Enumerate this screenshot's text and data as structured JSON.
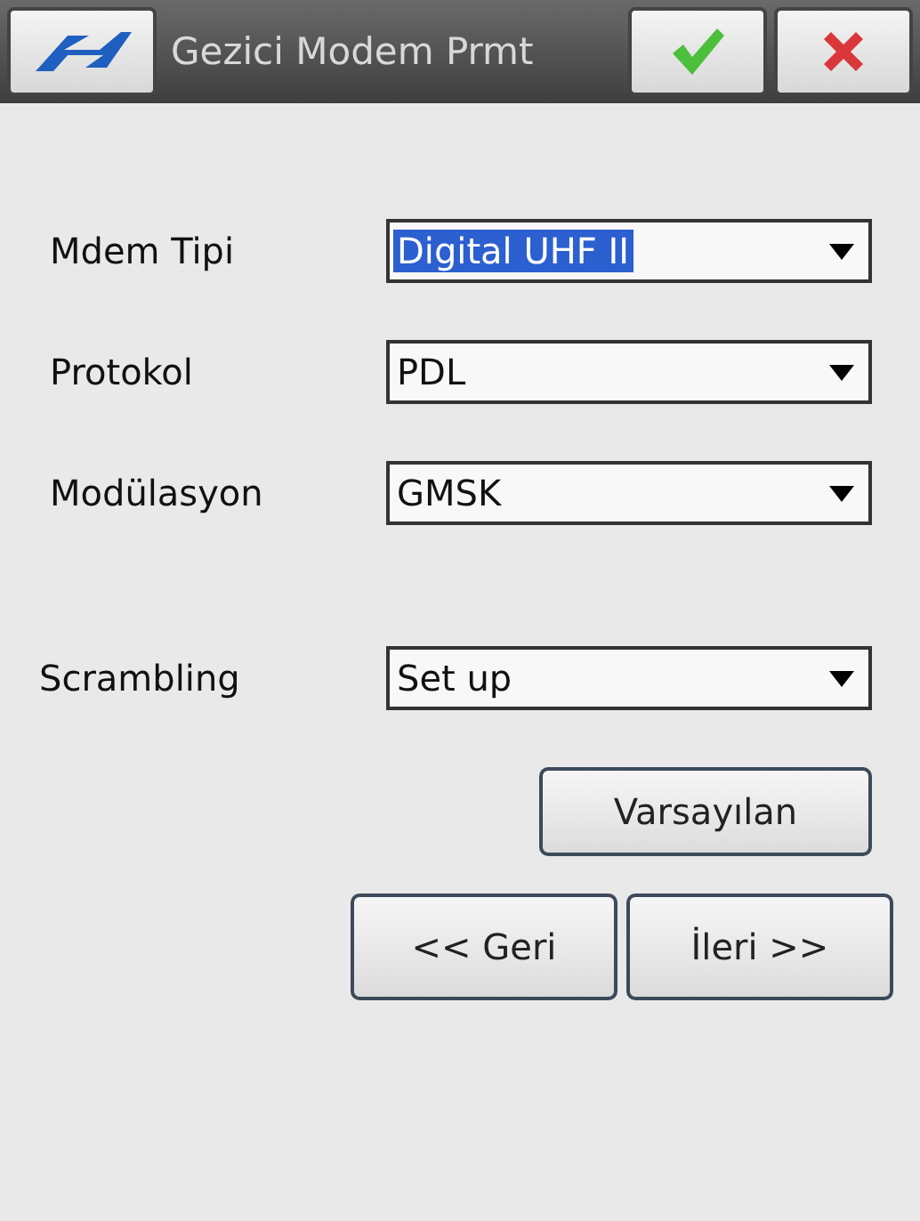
{
  "window": {
    "title": "Gezici Modem Prmt"
  },
  "fields": [
    {
      "label": "Mdem Tipi",
      "value": "Digital UHF II",
      "highlighted": true
    },
    {
      "label": "Protokol",
      "value": "PDL",
      "highlighted": false
    },
    {
      "label": "Modülasyon",
      "value": "GMSK",
      "highlighted": false
    }
  ],
  "scrambling": {
    "label": "Scrambling",
    "value": "Set up",
    "highlighted": false
  },
  "buttons": {
    "default": "Varsayılan",
    "back": "<< Geri",
    "next": "İleri >>"
  }
}
